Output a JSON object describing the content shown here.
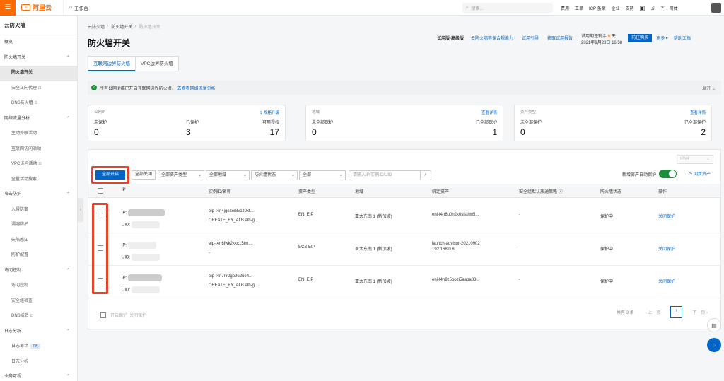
{
  "topbar": {
    "menu_icon": "☰",
    "brand": "阿里云",
    "brand_mark": "[-]",
    "workbench": "工作台",
    "search_placeholder": "搜索...",
    "nav": [
      "费用",
      "工单",
      "ICP 备案",
      "企业",
      "支持"
    ],
    "lang": "简体"
  },
  "sidebar": {
    "title": "云防火墙",
    "items": [
      {
        "label": "概览"
      },
      {
        "label": "防火墙开关",
        "group": true
      },
      {
        "label": "防火墙开关",
        "active": true
      },
      {
        "label": "安全正向代理",
        "lock": true
      },
      {
        "label": "DNS防火墙",
        "lock": true
      },
      {
        "label": "网络流量分析",
        "group": true
      },
      {
        "label": "主动外联活动"
      },
      {
        "label": "互联网访问活动"
      },
      {
        "label": "VPC访问活动",
        "lock": true
      },
      {
        "label": "全量活动搜索"
      },
      {
        "label": "攻击防护",
        "group": true
      },
      {
        "label": "入侵防御"
      },
      {
        "label": "漏洞防护"
      },
      {
        "label": "失陷感知"
      },
      {
        "label": "防护配置"
      },
      {
        "label": "访问控制",
        "group": true
      },
      {
        "label": "访问控制"
      },
      {
        "label": "安全组检查"
      },
      {
        "label": "DNS域名",
        "lock": true
      },
      {
        "label": "日志分析",
        "group": true
      },
      {
        "label": "日志审计",
        "tag": "7天"
      },
      {
        "label": "日志分析"
      },
      {
        "label": "业务可视",
        "group": true
      }
    ],
    "lock_glyph": "🔒"
  },
  "header": {
    "breadcrumb": [
      "云防火墙",
      "防火墙开关",
      "防火墙开关"
    ],
    "title": "防火墙开关",
    "edition": "试用版-高级版",
    "links": [
      "云防火墙等保合规能力",
      "试用引导",
      "获取试用报告"
    ],
    "trial_prefix": "试用期还剩余",
    "trial_days": "6",
    "trial_suffix": "天",
    "trial_date": "2021年9月23日 16:58",
    "buy_button": "前往购买",
    "more": "更多",
    "help": "帮助文档"
  },
  "tabs": [
    "互联网边界防火墙",
    "VPC边界防火墙"
  ],
  "notice": {
    "text": "所有公网IP都已开启互联网边界防火墙，",
    "link": "去查看网络流量分析",
    "expand": "展开"
  },
  "cards": [
    {
      "label": "公网IP",
      "link": "规格升级",
      "cols": [
        "未保护",
        "已保护",
        "可用授权"
      ],
      "values": [
        "0",
        "3",
        "17"
      ]
    },
    {
      "label": "地域",
      "link": "查看详情",
      "cols": [
        "未全部保护",
        "已全部保护"
      ],
      "values": [
        "0",
        "1"
      ]
    },
    {
      "label": "资产类型",
      "link": "查看详情",
      "cols": [
        "未全部保护",
        "已全部保护"
      ],
      "values": [
        "0",
        "2"
      ]
    }
  ],
  "toolbar": {
    "ip_version": "IPV4",
    "open_all": "全部开启",
    "close_all": "全部关闭",
    "filters": [
      "全部资产类型",
      "全部地域",
      "防火墙状态",
      "全部"
    ],
    "search_placeholder": "请输入IP/实例ID/UID",
    "auto_protect_label": "新增资产自动保护",
    "sync": "同步资产"
  },
  "table": {
    "columns": [
      "IP",
      "实例ID/名称",
      "资产类型",
      "地域",
      "绑定资产",
      "安全组默认放通策略",
      "防火墙状态",
      "操作"
    ],
    "rows": [
      {
        "ip_label": "IP:",
        "uid_label": "UID:",
        "instance": "eip-t4n4jqezer8v1z0xt...",
        "name": "CREATE_BY_ALB.alb-g...",
        "type": "ENI EIP",
        "region": "亚太东南 1 (新加坡)",
        "bound": "eni-t4n8u0n2k0sisthw5...",
        "bound2": "",
        "policy": "-",
        "status": "保护中",
        "action": "关闭保护"
      },
      {
        "ip_label": "IP:",
        "uid_label": "UID:",
        "instance": "eip-t4n6fwk2kkc15tm...",
        "name": "-",
        "type": "ECS EIP",
        "region": "亚太东南 1 (新加坡)",
        "bound": "launch-advisor-20210902",
        "bound2": "192.168.0.8",
        "policy": "-",
        "status": "保护中",
        "action": "关闭保护"
      },
      {
        "ip_label": "IP:",
        "uid_label": "UID:",
        "instance": "eip-t4n7nr2go9u2ue4...",
        "name": "CREATE_BY_ALB.alb-g...",
        "type": "ENI EIP",
        "region": "亚太东南 1 (新加坡)",
        "bound": "eni-t4n9z5bozi5aaba83...",
        "bound2": "",
        "policy": "-",
        "status": "保护中",
        "action": "关闭保护"
      }
    ],
    "footer_open": "开启保护",
    "footer_close": "关闭保护",
    "total": "共有 3 条",
    "prev": "上一页",
    "page": "1",
    "next": "下一页"
  },
  "colors": {
    "accent": "#0064c8",
    "brand": "#ff6a00",
    "highlight": "#e8412c",
    "toggle_on": "#1e8e3e"
  }
}
